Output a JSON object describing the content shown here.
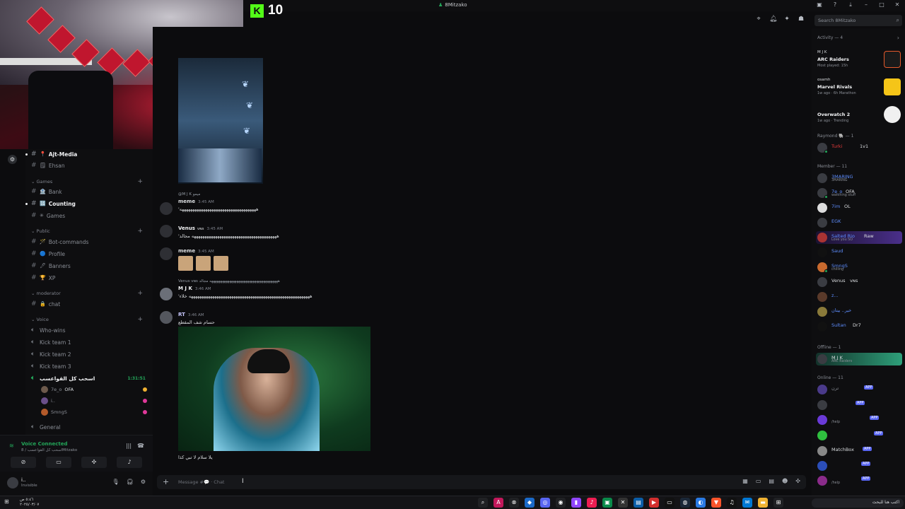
{
  "window": {
    "title": "8Mitzako"
  },
  "kick": {
    "logo": "K",
    "viewers": "10"
  },
  "search": {
    "placeholder": "Search 8Mitzako"
  },
  "channels": {
    "top": [
      {
        "name": "Ajt-Media",
        "emoji": "📍"
      },
      {
        "name": "Ehsan",
        "emoji": "🗒"
      }
    ],
    "games_cat": "Games",
    "games": [
      {
        "name": "Bank",
        "emoji": "🏦"
      },
      {
        "name": "Counting",
        "emoji": "🔢"
      },
      {
        "name": "Games",
        "emoji": "✳"
      }
    ],
    "public_cat": "Public",
    "public": [
      {
        "name": "Bot-commands",
        "emoji": "🪄"
      },
      {
        "name": "Profile",
        "emoji": "🔵"
      },
      {
        "name": "Banners",
        "emoji": "🖊"
      },
      {
        "name": "XP",
        "emoji": "🏆"
      }
    ],
    "mod_cat": "moderator",
    "mod": [
      {
        "name": "chat",
        "emoji": "🔒"
      }
    ],
    "voice_cat": "Voice",
    "voice": [
      {
        "name": "Who-wins"
      },
      {
        "name": "Kick team 1"
      },
      {
        "name": "Kick team 2"
      },
      {
        "name": "Kick team 3"
      },
      {
        "name": "اسحب كل القواعسب"
      }
    ],
    "voice_timer": "1:31:51",
    "voice_users": [
      {
        "name": "7e_o",
        "tag": "OFA"
      },
      {
        "name": "i.."
      },
      {
        "name": "SmngS"
      }
    ],
    "general": "General"
  },
  "voice_panel": {
    "status": "Voice Connected",
    "sub": "اسحب كل القواعسب / 8Mitzako"
  },
  "user_panel": {
    "name": "i..",
    "status": "Invisible"
  },
  "messages": [
    {
      "reply": "@M J K ميمو",
      "author": "meme",
      "time": "3:45 AM",
      "text": "'ههههههههههههههههههههههههههههههههههههه"
    },
    {
      "author": "Venus",
      "badge": "ᴠɴs",
      "time": "3:45 AM",
      "text": "'ههههههههههههههههههههههههههههههههههههههههه مجالد"
    },
    {
      "author": "meme",
      "time": "3:45 AM"
    },
    {
      "reply": "Venus ᴠɴs ههههههههههههههههههههههههههههههههههههههه مجالد",
      "author": "M J K",
      "time": "3:46 AM",
      "text": "'هههههههههههههههههههههههههههههههههههههههههههههههههههههههههه خلاء"
    },
    {
      "author": "RT",
      "time": "3:46 AM",
      "text": "حسام شف المقطع"
    }
  ],
  "caption": "يلا سلام لا تبي كذا",
  "composer": {
    "placeholder": "Message #💬 · Chat"
  },
  "activity": {
    "header": "Activity — 4",
    "cards": [
      {
        "user": "M J K",
        "game": "ARC Raiders",
        "meta": "Most played: 15h"
      },
      {
        "user": "osamh",
        "game": "Marvel Rivals",
        "meta": "1w ago · 6h Marathon"
      },
      {
        "user": "",
        "game": "Overwatch 2",
        "meta": "1w ago · Trending"
      }
    ]
  },
  "members": {
    "raymond_head": "Raymond 🐘 — 1",
    "raymond": [
      {
        "name": "Turki",
        "tag": "1v1"
      }
    ],
    "member_head": "Member — 11",
    "member": [
      {
        "name": "3MARING",
        "sub": "3MARING"
      },
      {
        "name": "7e_o",
        "tag": "OFA",
        "sub": "watching stuff"
      },
      {
        "name": "7im",
        "tag": "OL"
      },
      {
        "name": "EGK"
      },
      {
        "name": "Salted Rio",
        "tag": "Raw",
        "sub": "Love you SO"
      },
      {
        "name": "Saud"
      },
      {
        "name": "SmngS",
        "sub": "chilling"
      },
      {
        "name": "Venus",
        "tag": "ᴠɴs"
      },
      {
        "name": "z..."
      },
      {
        "name": "خير.. بيتان"
      },
      {
        "name": "Sultan",
        "tag": "Dr7"
      }
    ],
    "offline_head": "Offline — 1",
    "offline": [
      {
        "name": "M J K",
        "sub": "ARC Raiders"
      }
    ],
    "online_head": "Online — 11",
    "online": [
      {
        "name": "ترن",
        "app": "APP"
      },
      {
        "name": "",
        "app": "APP"
      },
      {
        "name": "",
        "app": "APP",
        "sub": "/help"
      },
      {
        "name": "",
        "app": "APP"
      },
      {
        "name": "MatchBox",
        "app": "APP"
      },
      {
        "name": "",
        "app": "APP"
      },
      {
        "name": "",
        "app": "APP",
        "sub": "/help"
      }
    ]
  },
  "taskbar": {
    "time": "٥:٤٦ ص",
    "date": "٢٠٢٥/٠٣/٠٧",
    "search_label": "اكتب هنا للبحث"
  },
  "colors": {
    "accent": "#5865f2",
    "online": "#23a559",
    "kick": "#53fc18",
    "bg": "#0c0c0e"
  }
}
